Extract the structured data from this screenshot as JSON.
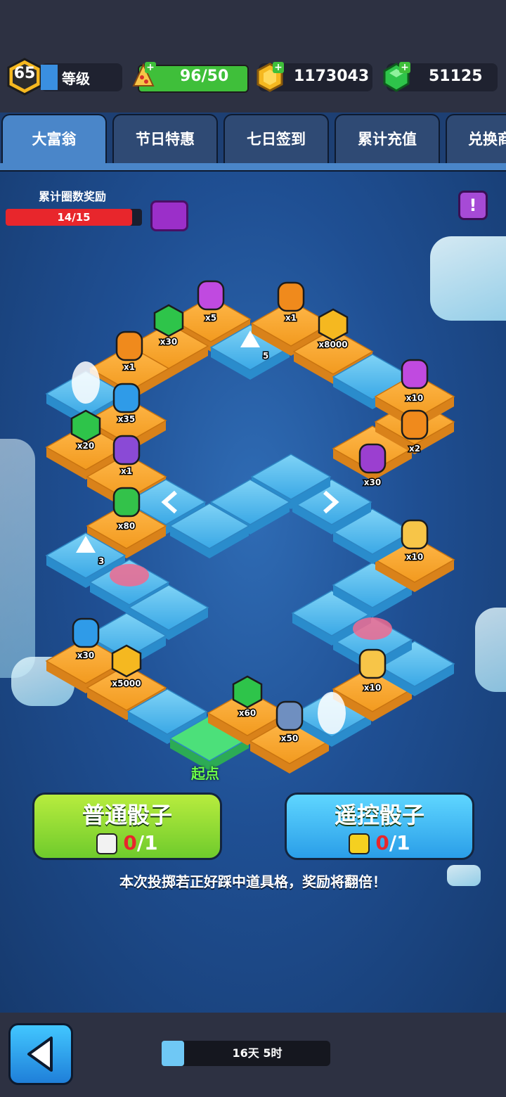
{
  "header": {
    "level": "65",
    "level_label": "等级",
    "pizza": "96/50",
    "coins": "1173043",
    "gems": "51125"
  },
  "tabs": [
    {
      "label": "大富翁",
      "active": true
    },
    {
      "label": "节日特惠",
      "active": false
    },
    {
      "label": "七日签到",
      "active": false
    },
    {
      "label": "累计充值",
      "active": false
    },
    {
      "label": "兑换商",
      "active": false
    }
  ],
  "progress": {
    "title": "累计圈数奖励",
    "text": "14/15",
    "fraction": 0.933
  },
  "info_label": "!",
  "board": {
    "start_label": "起点",
    "tiles": [
      {
        "name": "gem",
        "label": "x30"
      },
      {
        "name": "potion-purple",
        "label": "x5"
      },
      {
        "name": "potion-orange",
        "label": "x1"
      },
      {
        "name": "coin",
        "label": "x8000"
      },
      {
        "name": "potion-orange",
        "label": "x1"
      },
      {
        "name": "potion-blue",
        "label": "x35"
      },
      {
        "name": "gem",
        "label": "x20"
      },
      {
        "name": "key",
        "label": "x1"
      },
      {
        "name": "potion-green",
        "label": "x80"
      },
      {
        "name": "potion-purple",
        "label": "x10"
      },
      {
        "name": "potion-orange",
        "label": "x2"
      },
      {
        "name": "character",
        "label": "x30"
      },
      {
        "name": "pizza",
        "label": "x10"
      },
      {
        "name": "potion-blue",
        "label": "x30"
      },
      {
        "name": "coin",
        "label": "x5000"
      },
      {
        "name": "gem",
        "label": "x60"
      },
      {
        "name": "wrench",
        "label": "x50"
      },
      {
        "name": "pizza",
        "label": "x10"
      }
    ],
    "arrow_numbers": [
      "5",
      "3"
    ]
  },
  "buttons": {
    "normal": {
      "title": "普通骰子",
      "used": "0",
      "total": "/1"
    },
    "remote": {
      "title": "遥控骰子",
      "used": "0",
      "total": "/1"
    }
  },
  "hint": "本次投掷若正好踩中道具格，奖励将翻倍！",
  "timer": "16天 5时"
}
